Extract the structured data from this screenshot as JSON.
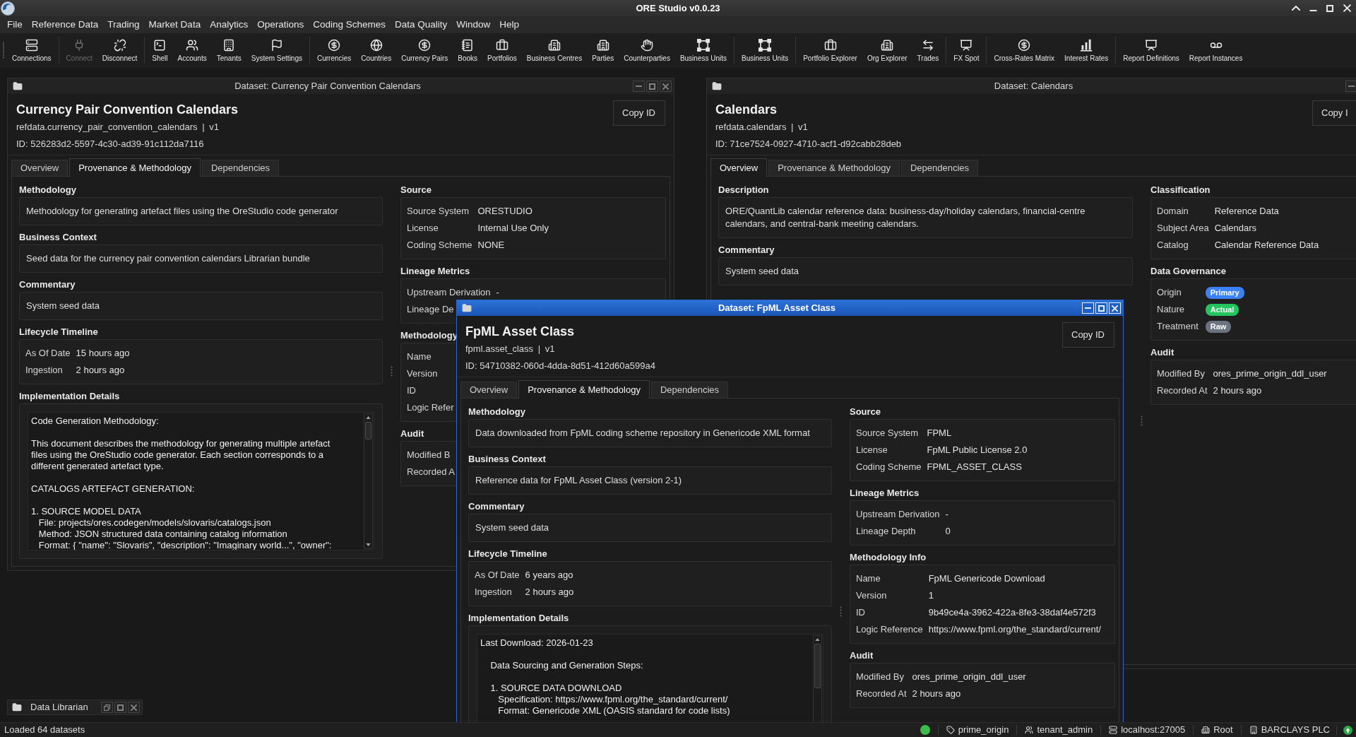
{
  "app": {
    "title": "ORE Studio v0.0.23"
  },
  "menu": [
    "File",
    "Reference Data",
    "Trading",
    "Market Data",
    "Analytics",
    "Operations",
    "Coding Schemes",
    "Data Quality",
    "Window",
    "Help"
  ],
  "toolbar": [
    {
      "items": [
        {
          "label": "Connections",
          "disabled": false
        }
      ]
    },
    {
      "items": [
        {
          "label": "Connect",
          "disabled": true
        },
        {
          "label": "Disconnect",
          "disabled": false
        }
      ]
    },
    {
      "items": [
        {
          "label": "Shell",
          "disabled": false
        },
        {
          "label": "Accounts",
          "disabled": false
        },
        {
          "label": "Tenants",
          "disabled": false
        },
        {
          "label": "System Settings",
          "disabled": false
        }
      ]
    },
    {
      "items": [
        {
          "label": "Currencies",
          "disabled": false
        },
        {
          "label": "Countries",
          "disabled": false
        },
        {
          "label": "Currency Pairs",
          "disabled": false
        },
        {
          "label": "Books",
          "disabled": false
        },
        {
          "label": "Portfolios",
          "disabled": false
        },
        {
          "label": "Business Centres",
          "disabled": false
        },
        {
          "label": "Parties",
          "disabled": false
        },
        {
          "label": "Counterparties",
          "disabled": false
        },
        {
          "label": "Business Units",
          "disabled": false
        }
      ]
    },
    {
      "items": [
        {
          "label": "Business Units",
          "disabled": false
        }
      ]
    },
    {
      "items": [
        {
          "label": "Portfolio Explorer",
          "disabled": false
        },
        {
          "label": "Org Explorer",
          "disabled": false
        },
        {
          "label": "Trades",
          "disabled": false
        }
      ]
    },
    {
      "items": [
        {
          "label": "FX Spot",
          "disabled": false
        }
      ]
    },
    {
      "items": [
        {
          "label": "Cross-Rates Matrix",
          "disabled": false
        },
        {
          "label": "Interest Rates",
          "disabled": false
        }
      ]
    },
    {
      "items": [
        {
          "label": "Report Definitions",
          "disabled": false
        },
        {
          "label": "Report Instances",
          "disabled": false
        }
      ]
    }
  ],
  "windows": [
    {
      "title": "Dataset: Currency Pair Convention Calendars",
      "active": false,
      "heading": "Currency Pair Convention Calendars",
      "subtitle": "refdata.currency_pair_convention_calendars | v1",
      "id": "ID: 526283d2-5597-4c30-ad39-91c112da7116",
      "copy_button": "Copy ID",
      "tabs": [
        {
          "label": "Overview",
          "selected": false
        },
        {
          "label": "Provenance & Methodology",
          "selected": true
        },
        {
          "label": "Dependencies",
          "selected": false
        }
      ],
      "columns": [
        [
          {
            "kind": "text",
            "label": "Methodology",
            "text": "Methodology for generating artefact files using the OreStudio code generator"
          },
          {
            "kind": "text",
            "label": "Business Context",
            "text": "Seed data for the currency pair convention calendars Librarian bundle"
          },
          {
            "kind": "text",
            "label": "Commentary",
            "text": "System seed data"
          },
          {
            "kind": "fields",
            "label": "Lifecycle Timeline",
            "rows": [
              {
                "label": "As Of Date",
                "value": "15 hours ago"
              },
              {
                "label": "Ingestion",
                "value": "2 hours ago"
              }
            ]
          },
          {
            "kind": "document",
            "label": "Implementation Details",
            "text": "Code Generation Methodology:\n\nThis document describes the methodology for generating multiple artefact\nfiles using the OreStudio code generator. Each section corresponds to a\ndifferent generated artefact type.\n\nCATALOGS ARTEFACT GENERATION:\n\n1. SOURCE MODEL DATA\n   File: projects/ores.codegen/models/slovaris/catalogs.json\n   Method: JSON structured data containing catalog information\n   Format: { \"name\": \"Slovaris\", \"description\": \"Imaginary world...\", \"owner\":"
          }
        ],
        [
          {
            "kind": "fields",
            "label": "Source",
            "rows": [
              {
                "label": "Source System",
                "value": "ORESTUDIO"
              },
              {
                "label": "License",
                "value": "Internal Use Only"
              },
              {
                "label": "Coding Scheme",
                "value": "NONE"
              }
            ]
          },
          {
            "kind": "fields",
            "label": "Lineage Metrics",
            "rows": [
              {
                "label": "Upstream Derivation",
                "value": "-"
              },
              {
                "label": "Lineage De"
              }
            ]
          },
          {
            "kind": "fields",
            "label": "Methodology",
            "rows": [
              {
                "label": "Name"
              },
              {
                "label": "Version"
              },
              {
                "label": "ID"
              },
              {
                "label": "Logic Refer"
              }
            ]
          },
          {
            "kind": "fields",
            "label": "Audit",
            "rows": [
              {
                "label": "Modified B"
              },
              {
                "label": "Recorded A"
              }
            ]
          }
        ]
      ]
    },
    {
      "title": "Dataset: Calendars",
      "active": false,
      "heading": "Calendars",
      "subtitle": "refdata.calendars | v1",
      "id": "ID: 71ce7524-0927-4710-acf1-d92cabb28deb",
      "copy_button": "Copy I",
      "tabs": [
        {
          "label": "Overview",
          "selected": true
        },
        {
          "label": "Provenance & Methodology",
          "selected": false
        },
        {
          "label": "Dependencies",
          "selected": false
        }
      ],
      "columns": [
        [
          {
            "kind": "text",
            "label": "Description",
            "text": "ORE/QuantLib calendar reference data: business-day/holiday calendars, financial-centre calendars, and central-bank meeting calendars."
          },
          {
            "kind": "text",
            "label": "Commentary",
            "text": "System seed data"
          }
        ],
        [
          {
            "kind": "fields",
            "label": "Classification",
            "rows": [
              {
                "label": "Domain",
                "value": "Reference Data"
              },
              {
                "label": "Subject Area",
                "value": "Calendars"
              },
              {
                "label": "Catalog",
                "value": "Calendar Reference Data"
              }
            ]
          },
          {
            "kind": "badges",
            "label": "Data Governance",
            "rows": [
              {
                "label": "Origin",
                "badge": "Primary",
                "color": "#3b82f6"
              },
              {
                "label": "Nature",
                "badge": "Actual",
                "color": "#22c55e"
              },
              {
                "label": "Treatment",
                "badge": "Raw",
                "color": "#6b7280"
              }
            ]
          },
          {
            "kind": "fields",
            "label": "Audit",
            "rows": [
              {
                "label": "Modified By",
                "value": "ores_prime_origin_ddl_user"
              },
              {
                "label": "Recorded At",
                "value": "2 hours ago"
              }
            ]
          }
        ]
      ]
    },
    {
      "title": "Dataset: FpML Asset Class",
      "active": true,
      "heading": "FpML Asset Class",
      "subtitle": "fpml.asset_class | v1",
      "id": "ID: 54710382-060d-4dda-8d51-412d60a599a4",
      "copy_button": "Copy ID",
      "tabs": [
        {
          "label": "Overview",
          "selected": false
        },
        {
          "label": "Provenance & Methodology",
          "selected": true
        },
        {
          "label": "Dependencies",
          "selected": false
        }
      ],
      "columns": [
        [
          {
            "kind": "text",
            "label": "Methodology",
            "text": "Data downloaded from FpML coding scheme repository in Genericode XML format"
          },
          {
            "kind": "text",
            "label": "Business Context",
            "text": "Reference data for FpML Asset Class (version 2-1)"
          },
          {
            "kind": "text",
            "label": "Commentary",
            "text": "System seed data"
          },
          {
            "kind": "fields",
            "label": "Lifecycle Timeline",
            "rows": [
              {
                "label": "As Of Date",
                "value": "6 years ago"
              },
              {
                "label": "Ingestion",
                "value": "2 hours ago"
              }
            ]
          },
          {
            "kind": "document",
            "label": "Implementation Details",
            "text": "Last Download: 2026-01-23\n\n    Data Sourcing and Generation Steps:\n\n    1. SOURCE DATA DOWNLOAD\n       Specification: https://www.fpml.org/the_standard/current/\n       Format: Genericode XML (OASIS standard for code lists)"
          }
        ],
        [
          {
            "kind": "fields",
            "label": "Source",
            "rows": [
              {
                "label": "Source System",
                "value": "FPML"
              },
              {
                "label": "License",
                "value": "FpML Public License 2.0"
              },
              {
                "label": "Coding Scheme",
                "value": "FPML_ASSET_CLASS"
              }
            ]
          },
          {
            "kind": "fields",
            "label": "Lineage Metrics",
            "rows": [
              {
                "label": "Upstream Derivation",
                "value": "-"
              },
              {
                "label": "Lineage Depth",
                "value": "0"
              }
            ]
          },
          {
            "kind": "fields",
            "label": "Methodology Info",
            "rows": [
              {
                "label": "Name",
                "value": "FpML Genericode Download"
              },
              {
                "label": "Version",
                "value": "1"
              },
              {
                "label": "ID",
                "value": "9b49ce4a-3962-422a-8fe3-38daf4e572f3"
              },
              {
                "label": "Logic Reference",
                "value": "https://www.fpml.org/the_standard/current/"
              }
            ]
          },
          {
            "kind": "fields",
            "label": "Audit",
            "rows": [
              {
                "label": "Modified By",
                "value": "ores_prime_origin_ddl_user"
              },
              {
                "label": "Recorded At",
                "value": "2 hours ago"
              }
            ]
          }
        ]
      ]
    }
  ],
  "minimized_windows": [
    {
      "title": "Data Librarian"
    }
  ],
  "status_bar": {
    "message": "Loaded 64 datasets",
    "items": [
      {
        "label": "prime_origin"
      },
      {
        "label": "tenant_admin"
      },
      {
        "label": "localhost:27005"
      },
      {
        "label": "Root"
      },
      {
        "label": "BARCLAYS PLC"
      }
    ]
  }
}
